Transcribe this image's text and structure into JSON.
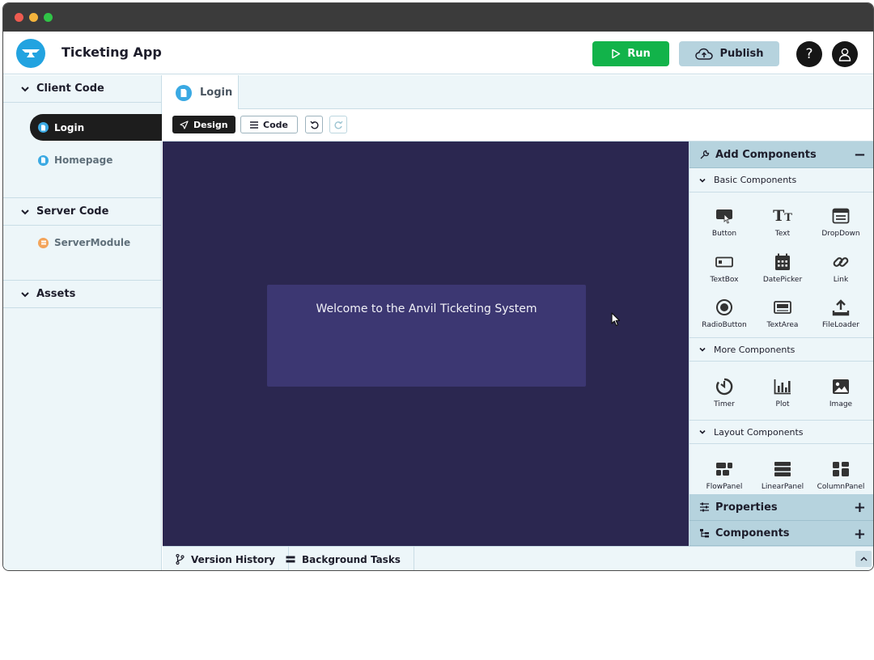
{
  "window": {
    "dots": [
      "#ee5b50",
      "#f4b43c",
      "#30c447"
    ]
  },
  "header": {
    "app_title": "Ticketing App",
    "run_label": "Run",
    "publish_label": "Publish",
    "help_glyph": "?",
    "colors": {
      "run": "#12b34a",
      "publish": "#b6d3de"
    }
  },
  "sidebar": {
    "client_code": {
      "title": "Client Code",
      "items": [
        {
          "label": "Login",
          "active": true
        },
        {
          "label": "Homepage",
          "active": false
        }
      ]
    },
    "server_code": {
      "title": "Server Code",
      "items": [
        {
          "label": "ServerModule"
        }
      ]
    },
    "assets": {
      "title": "Assets"
    }
  },
  "editor": {
    "tab_label": "Login",
    "toolbar": {
      "design_label": "Design",
      "code_label": "Code"
    },
    "canvas": {
      "welcome_text": "Welcome to the Anvil Ticketing System",
      "colors": {
        "background": "#2b2750",
        "card": "#3c3772"
      }
    }
  },
  "right_panel": {
    "add_components": {
      "title": "Add Components",
      "toggle": "−",
      "basic": {
        "title": "Basic Components",
        "items": [
          "Button",
          "Text",
          "DropDown",
          "TextBox",
          "DatePicker",
          "Link",
          "RadioButton",
          "TextArea",
          "FileLoader"
        ]
      },
      "more": {
        "title": "More Components",
        "items": [
          "Timer",
          "Plot",
          "Image"
        ]
      },
      "layout": {
        "title": "Layout Components",
        "items": [
          "FlowPanel",
          "LinearPanel",
          "ColumnPanel"
        ]
      }
    },
    "properties": {
      "title": "Properties",
      "toggle": "+"
    },
    "components": {
      "title": "Components",
      "toggle": "+"
    }
  },
  "statusbar": {
    "version_history": "Version History",
    "background_tasks": "Background Tasks"
  }
}
